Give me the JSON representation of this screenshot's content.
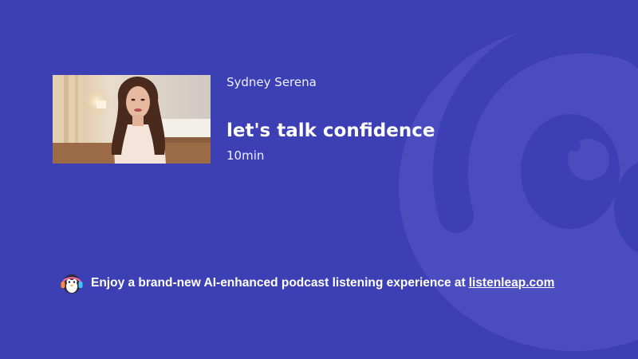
{
  "episode": {
    "author": "Sydney Serena",
    "title": "let's talk confidence",
    "duration": "10min",
    "thumbnail_icon": "episode-thumbnail-image"
  },
  "promo": {
    "text": "Enjoy a brand-new AI-enhanced podcast listening experience at",
    "link_label": "listenleap.com",
    "logo_icon": "penguin-headphones-icon"
  },
  "colors": {
    "background": "#3d3fb4",
    "mascot_shape": "#4a4fc0",
    "text": "#ffffff"
  }
}
